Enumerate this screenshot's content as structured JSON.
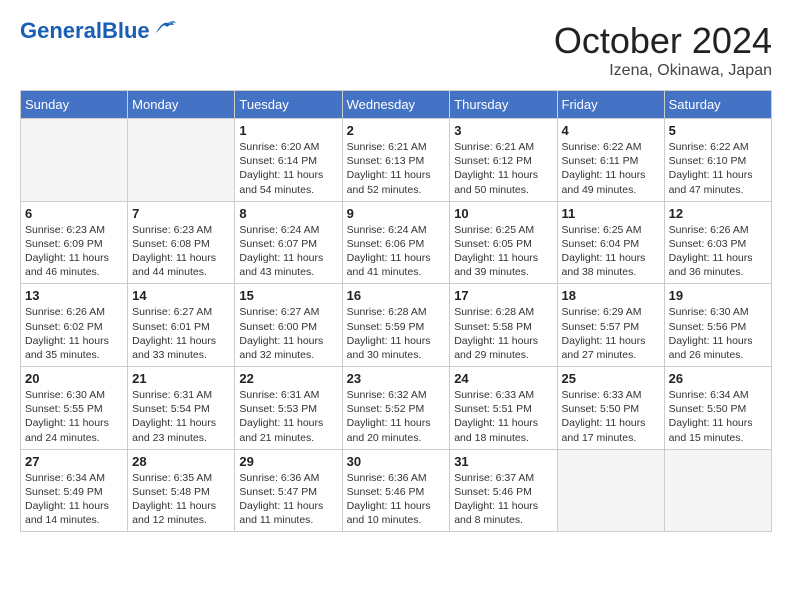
{
  "header": {
    "logo_general": "General",
    "logo_blue": "Blue",
    "month": "October 2024",
    "location": "Izena, Okinawa, Japan"
  },
  "days_of_week": [
    "Sunday",
    "Monday",
    "Tuesday",
    "Wednesday",
    "Thursday",
    "Friday",
    "Saturday"
  ],
  "weeks": [
    [
      {
        "day": "",
        "info": ""
      },
      {
        "day": "",
        "info": ""
      },
      {
        "day": "1",
        "info": "Sunrise: 6:20 AM\nSunset: 6:14 PM\nDaylight: 11 hours and 54 minutes."
      },
      {
        "day": "2",
        "info": "Sunrise: 6:21 AM\nSunset: 6:13 PM\nDaylight: 11 hours and 52 minutes."
      },
      {
        "day": "3",
        "info": "Sunrise: 6:21 AM\nSunset: 6:12 PM\nDaylight: 11 hours and 50 minutes."
      },
      {
        "day": "4",
        "info": "Sunrise: 6:22 AM\nSunset: 6:11 PM\nDaylight: 11 hours and 49 minutes."
      },
      {
        "day": "5",
        "info": "Sunrise: 6:22 AM\nSunset: 6:10 PM\nDaylight: 11 hours and 47 minutes."
      }
    ],
    [
      {
        "day": "6",
        "info": "Sunrise: 6:23 AM\nSunset: 6:09 PM\nDaylight: 11 hours and 46 minutes."
      },
      {
        "day": "7",
        "info": "Sunrise: 6:23 AM\nSunset: 6:08 PM\nDaylight: 11 hours and 44 minutes."
      },
      {
        "day": "8",
        "info": "Sunrise: 6:24 AM\nSunset: 6:07 PM\nDaylight: 11 hours and 43 minutes."
      },
      {
        "day": "9",
        "info": "Sunrise: 6:24 AM\nSunset: 6:06 PM\nDaylight: 11 hours and 41 minutes."
      },
      {
        "day": "10",
        "info": "Sunrise: 6:25 AM\nSunset: 6:05 PM\nDaylight: 11 hours and 39 minutes."
      },
      {
        "day": "11",
        "info": "Sunrise: 6:25 AM\nSunset: 6:04 PM\nDaylight: 11 hours and 38 minutes."
      },
      {
        "day": "12",
        "info": "Sunrise: 6:26 AM\nSunset: 6:03 PM\nDaylight: 11 hours and 36 minutes."
      }
    ],
    [
      {
        "day": "13",
        "info": "Sunrise: 6:26 AM\nSunset: 6:02 PM\nDaylight: 11 hours and 35 minutes."
      },
      {
        "day": "14",
        "info": "Sunrise: 6:27 AM\nSunset: 6:01 PM\nDaylight: 11 hours and 33 minutes."
      },
      {
        "day": "15",
        "info": "Sunrise: 6:27 AM\nSunset: 6:00 PM\nDaylight: 11 hours and 32 minutes."
      },
      {
        "day": "16",
        "info": "Sunrise: 6:28 AM\nSunset: 5:59 PM\nDaylight: 11 hours and 30 minutes."
      },
      {
        "day": "17",
        "info": "Sunrise: 6:28 AM\nSunset: 5:58 PM\nDaylight: 11 hours and 29 minutes."
      },
      {
        "day": "18",
        "info": "Sunrise: 6:29 AM\nSunset: 5:57 PM\nDaylight: 11 hours and 27 minutes."
      },
      {
        "day": "19",
        "info": "Sunrise: 6:30 AM\nSunset: 5:56 PM\nDaylight: 11 hours and 26 minutes."
      }
    ],
    [
      {
        "day": "20",
        "info": "Sunrise: 6:30 AM\nSunset: 5:55 PM\nDaylight: 11 hours and 24 minutes."
      },
      {
        "day": "21",
        "info": "Sunrise: 6:31 AM\nSunset: 5:54 PM\nDaylight: 11 hours and 23 minutes."
      },
      {
        "day": "22",
        "info": "Sunrise: 6:31 AM\nSunset: 5:53 PM\nDaylight: 11 hours and 21 minutes."
      },
      {
        "day": "23",
        "info": "Sunrise: 6:32 AM\nSunset: 5:52 PM\nDaylight: 11 hours and 20 minutes."
      },
      {
        "day": "24",
        "info": "Sunrise: 6:33 AM\nSunset: 5:51 PM\nDaylight: 11 hours and 18 minutes."
      },
      {
        "day": "25",
        "info": "Sunrise: 6:33 AM\nSunset: 5:50 PM\nDaylight: 11 hours and 17 minutes."
      },
      {
        "day": "26",
        "info": "Sunrise: 6:34 AM\nSunset: 5:50 PM\nDaylight: 11 hours and 15 minutes."
      }
    ],
    [
      {
        "day": "27",
        "info": "Sunrise: 6:34 AM\nSunset: 5:49 PM\nDaylight: 11 hours and 14 minutes."
      },
      {
        "day": "28",
        "info": "Sunrise: 6:35 AM\nSunset: 5:48 PM\nDaylight: 11 hours and 12 minutes."
      },
      {
        "day": "29",
        "info": "Sunrise: 6:36 AM\nSunset: 5:47 PM\nDaylight: 11 hours and 11 minutes."
      },
      {
        "day": "30",
        "info": "Sunrise: 6:36 AM\nSunset: 5:46 PM\nDaylight: 11 hours and 10 minutes."
      },
      {
        "day": "31",
        "info": "Sunrise: 6:37 AM\nSunset: 5:46 PM\nDaylight: 11 hours and 8 minutes."
      },
      {
        "day": "",
        "info": ""
      },
      {
        "day": "",
        "info": ""
      }
    ]
  ]
}
